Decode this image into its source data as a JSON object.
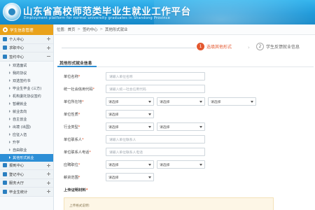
{
  "header": {
    "title": "山东省高校师范类毕业生就业工作平台",
    "subtitle": "Employment platform for normal university graduates in Shandong Province"
  },
  "sidebar": {
    "section": "学生信息管理",
    "groups": [
      {
        "label": "个人中心"
      },
      {
        "label": "求职中心"
      },
      {
        "label": "签约中心"
      }
    ],
    "sub_items": [
      {
        "label": "双选面试"
      },
      {
        "label": "我的协议"
      },
      {
        "label": "双选签约书"
      },
      {
        "label": "毕业生毕业 (三方)"
      },
      {
        "label": "机构委托协议签约"
      },
      {
        "label": "暂缓就业"
      },
      {
        "label": "就业去向"
      },
      {
        "label": "自主创业"
      },
      {
        "label": "出境 (出国)"
      },
      {
        "label": "应征入伍"
      },
      {
        "label": "升学"
      },
      {
        "label": "自由职业"
      },
      {
        "label": "其他形式就业"
      }
    ],
    "bottom_groups": [
      {
        "label": "报到中心"
      },
      {
        "label": "登记中心"
      },
      {
        "label": "服务大厅"
      },
      {
        "label": "毕业生统计"
      }
    ]
  },
  "breadcrumb": {
    "prefix": "位置:",
    "items": [
      "首页",
      "签约中心",
      "其他形式就业"
    ],
    "separator": ">"
  },
  "steps": [
    {
      "num": "1",
      "label": "选填其他形式"
    },
    {
      "num": "2",
      "label": "学生反馈就业信息"
    }
  ],
  "section_title": "其他形式就业信息",
  "form": {
    "unit_name": {
      "label": "单位名称",
      "placeholder": "请输入单位名称"
    },
    "credit_code": {
      "label": "统一社会信用代码",
      "placeholder": "请输入统一社会信用代码"
    },
    "unit_location": {
      "label": "单位所在地",
      "options": [
        "请选择",
        "请选择",
        "请选择"
      ]
    },
    "unit_nature": {
      "label": "单位性质",
      "value": "请选择"
    },
    "industry": {
      "label": "行业类型",
      "options": [
        "请选择",
        "请选择"
      ]
    },
    "contact_person": {
      "label": "单位联系人",
      "placeholder": "请输入单位联系人"
    },
    "contact_phone": {
      "label": "单位联系人电话",
      "placeholder": "请输入单位联系人电话"
    },
    "position": {
      "label": "应聘职位",
      "options": [
        "请选择",
        "请选择"
      ]
    },
    "salary": {
      "label": "薪资范围",
      "value": "请选择"
    },
    "upload": {
      "label": "上传证明材料"
    },
    "notice": "上传格式说明:"
  },
  "colors": {
    "header_blue": "#1c98d9",
    "sidebar_active": "#2d8fd6",
    "section_orange": "#e9a21b",
    "step_active": "#e3572e"
  }
}
